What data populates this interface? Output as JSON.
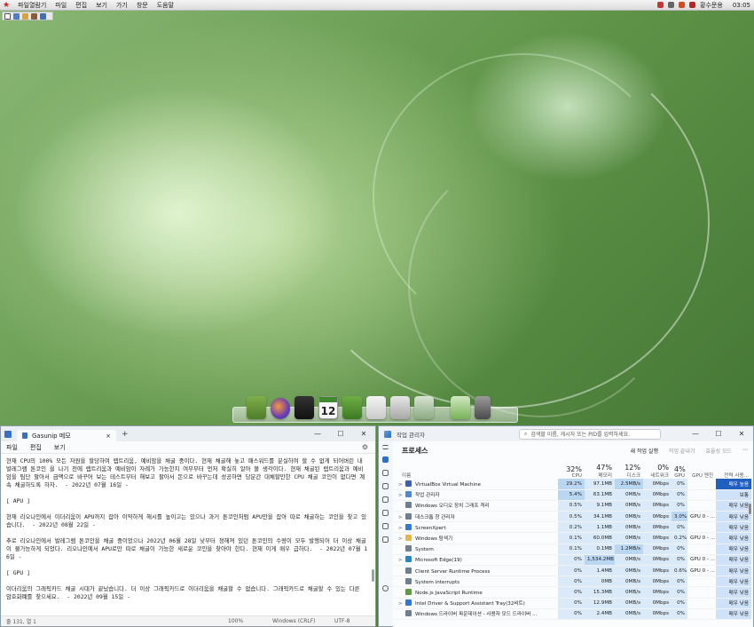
{
  "menubar": {
    "items": [
      "파일열람기",
      "파일",
      "편집",
      "보기",
      "가기",
      "창문",
      "도움말"
    ],
    "tray_label": "황수문용",
    "clock": "03:05"
  },
  "dock": {
    "calendar_day": "12"
  },
  "notepad": {
    "tab_title": "Gasunip 메모",
    "tab_close": "×",
    "new_tab": "+",
    "controls": [
      "—",
      "☐",
      "✕"
    ],
    "menu": [
      "파일",
      "편집",
      "보기"
    ],
    "paragraphs": [
      "현재 CPU의 100% 모든 자원을 할당하여 렙트리움, 예비암을 채굴 중이다. 현재 채굴해 놓고 패스워드를 분실하여 할 수 없게 되어버린 내 발레그램 톤코인 을 나기 전에 렙트리움과 예비암이 자례가 가능한지 여부부터 먼저 확실히 알아 볼 생각이다. 현재 채굴된 렙트리움과 예비암을 팀단 팔아서 금액으로 바꾸어 보는 테스트부터 해보고 팔아서 돈으로 바꾸는데 성공하면 당분간 대체할만한 CPU 채굴 코인이 없다면 계속 채굴하도록 하자.  - 2022년 07월 16일 -",
      "[ APU ]",
      "현재 리오나인에서 이더리움이 APU까지 잡아 이약하게 해시를 높이고는 있으나 과거 톤코인처럼 APU만을 잡아 따로 채굴하는 코인을 찾고 있습니다.  - 2022년 08월 22일 -",
      "추로 리오나인에서 발레그램 톤코인을 채굴 중이었으나 2022년 06월 28일 낮부터 정해져 있던 톤코인의 수량이 모두 발행되어 더 이상 채굴이 불가능하게 되었다. 리오나인에서 APU로만 따로 채굴이 가능한 새로운 코인을 찾아야 한다. 현재 이게 매우 급하다.  - 2022년 07월 16일 -",
      "[ GPU ]",
      "이더리움의 그래픽카드 채굴 시대가 끝났습니다. 더 이상 그래픽카드로 이더리움을 채굴할 수 없습니다. 그래픽카드로 채굴할 수 있는 다른 암호화폐를 찾으세요.  - 2022년 09월 15일 -"
    ],
    "status": {
      "position": "줄 131, 열 1",
      "zoom": "100%",
      "line_ending": "Windows (CRLF)",
      "encoding": "UTF-8"
    }
  },
  "taskmgr": {
    "title": "작업 관리자",
    "search_placeholder": "검색할 이름, 게시자 또는 PID를 입력하세요.",
    "controls": [
      "—",
      "☐",
      "✕"
    ],
    "section_title": "프로세스",
    "actions": [
      "새 작업 실행",
      "작업 끝내기",
      "효율성 모드",
      "⋯"
    ],
    "columns": {
      "name": "이름",
      "cpu_pct": "32%",
      "cpu": "CPU",
      "mem_pct": "47%",
      "mem": "메모리",
      "disk_pct": "12%",
      "disk": "디스크",
      "net_pct": "0%",
      "net": "네트워크",
      "gpu_pct": "4%",
      "gpu": "GPU",
      "gpu_engine": "GPU 엔진",
      "power": "전력 사용..."
    },
    "rows": [
      {
        "expand": ">",
        "name": "VirtualBox Virtual Machine",
        "cpu": "29.2%",
        "mem": "97.1MB",
        "disk": "2.5MB/s",
        "net": "0Mbps",
        "gpu": "0%",
        "engine": "",
        "power": "매우 높음",
        "icon_color": "#3a62b0"
      },
      {
        "expand": ">",
        "name": "작업 관리자",
        "cpu": "5.4%",
        "mem": "63.1MB",
        "disk": "0MB/s",
        "net": "0Mbps",
        "gpu": "0%",
        "engine": "",
        "power": "보통",
        "icon_color": "#4c8ad6"
      },
      {
        "expand": "",
        "name": "Windows 오디오 장치 그래프 격리",
        "cpu": "0.5%",
        "mem": "9.1MB",
        "disk": "0MB/s",
        "net": "0Mbps",
        "gpu": "0%",
        "engine": "",
        "power": "매우 낮음",
        "icon_color": "#6d7f92"
      },
      {
        "expand": ">",
        "name": "데스크톱 창 관리자",
        "cpu": "0.5%",
        "mem": "34.1MB",
        "disk": "0MB/s",
        "net": "0Mbps",
        "gpu": "3.0%",
        "engine": "GPU 0 - ...",
        "power": "매우 낮음",
        "icon_color": "#6d7f92"
      },
      {
        "expand": ">",
        "name": "ScreenXpert",
        "cpu": "0.2%",
        "mem": "1.1MB",
        "disk": "0MB/s",
        "net": "0Mbps",
        "gpu": "0%",
        "engine": "",
        "power": "매우 낮음",
        "icon_color": "#2f7bd4"
      },
      {
        "expand": ">",
        "name": "Windows 탐색기",
        "cpu": "0.1%",
        "mem": "60.0MB",
        "disk": "0MB/s",
        "net": "0Mbps",
        "gpu": "0.2%",
        "engine": "GPU 0 - ...",
        "power": "매우 낮음",
        "icon_color": "#e9b840"
      },
      {
        "expand": "",
        "name": "System",
        "cpu": "0.1%",
        "mem": "0.1MB",
        "disk": "1.2MB/s",
        "net": "0Mbps",
        "gpu": "0%",
        "engine": "",
        "power": "매우 낮음",
        "icon_color": "#6d7f92"
      },
      {
        "expand": ">",
        "name": "Microsoft Edge(19)",
        "cpu": "0%",
        "mem": "1,534.2MB",
        "disk": "0MB/s",
        "net": "0Mbps",
        "gpu": "0%",
        "engine": "GPU 0 - ...",
        "power": "매우 낮음",
        "icon_color": "#1e88c9"
      },
      {
        "expand": "",
        "name": "Client Server Runtime Process",
        "cpu": "0%",
        "mem": "1.4MB",
        "disk": "0MB/s",
        "net": "0Mbps",
        "gpu": "0.6%",
        "engine": "GPU 0 - ...",
        "power": "매우 낮음",
        "icon_color": "#6d7f92"
      },
      {
        "expand": "",
        "name": "System interrupts",
        "cpu": "0%",
        "mem": "0MB",
        "disk": "0MB/s",
        "net": "0Mbps",
        "gpu": "0%",
        "engine": "",
        "power": "매우 낮음",
        "icon_color": "#6d7f92"
      },
      {
        "expand": "",
        "name": "Node.js JavaScript Runtime",
        "cpu": "0%",
        "mem": "15.3MB",
        "disk": "0MB/s",
        "net": "0Mbps",
        "gpu": "0%",
        "engine": "",
        "power": "매우 낮음",
        "icon_color": "#5f9c3d"
      },
      {
        "expand": ">",
        "name": "Intel Driver & Support Assistant Tray(32비트)",
        "cpu": "0%",
        "mem": "12.9MB",
        "disk": "0MB/s",
        "net": "0Mbps",
        "gpu": "0%",
        "engine": "",
        "power": "매우 낮음",
        "icon_color": "#2b7bd0"
      },
      {
        "expand": "",
        "name": "Windows 드라이버 파운데이션 - 사용자 모드 드라이버 ...",
        "cpu": "0%",
        "mem": "2.4MB",
        "disk": "0MB/s",
        "net": "0Mbps",
        "gpu": "0%",
        "engine": "",
        "power": "매우 낮음",
        "icon_color": "#6d7f92"
      }
    ]
  },
  "colors": {
    "wallpaper_dark": "#3e6c30",
    "wallpaper_light": "#b7d89a",
    "accent_blue": "#1f5fbf",
    "heat_yellow": "#ffe79a"
  }
}
